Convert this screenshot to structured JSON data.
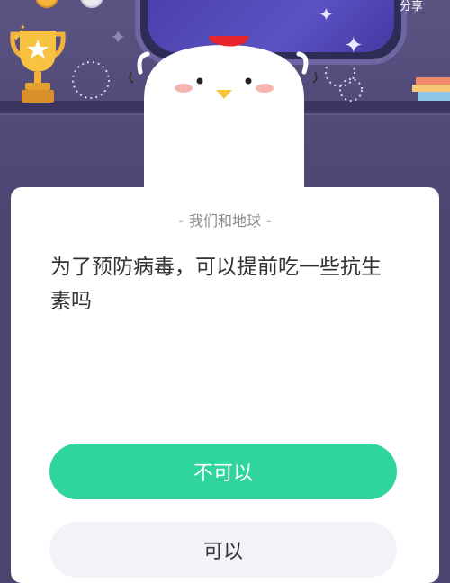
{
  "header": {
    "share_label": "分享"
  },
  "quiz": {
    "category": "我们和地球",
    "category_dash": "-",
    "question": "为了预防病毒，可以提前吃一些抗生素吗"
  },
  "answers": [
    {
      "label": "不可以"
    },
    {
      "label": "可以"
    }
  ],
  "colors": {
    "primary_button": "#2fd59d",
    "secondary_button": "#f1f3f8",
    "scene_background": "#514a78"
  },
  "icons": [
    "trophy-icon",
    "medal-icon",
    "star-icon",
    "chicken-mascot",
    "book-stack-icon"
  ]
}
